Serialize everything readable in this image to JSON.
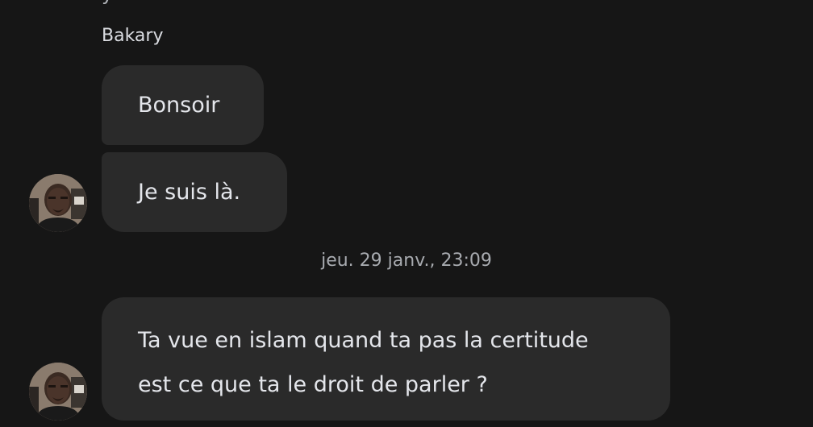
{
  "header": {
    "partial_text": "y"
  },
  "conversation": {
    "sender_name": "Bakary",
    "messages": [
      {
        "text": "Bonsoir"
      },
      {
        "text": "Je suis là."
      }
    ],
    "separator_timestamp": "jeu. 29 janv., 23:09",
    "latest_message": {
      "line1": "Ta vue en islam quand ta pas la certitude",
      "line2": "est ce que ta le droit de parler ?"
    }
  },
  "colors": {
    "background": "#161616",
    "bubble": "#2a2a2a",
    "text": "#e4e6eb",
    "muted_text": "#a8abb0"
  },
  "icons": {
    "avatar": "profile-photo"
  }
}
